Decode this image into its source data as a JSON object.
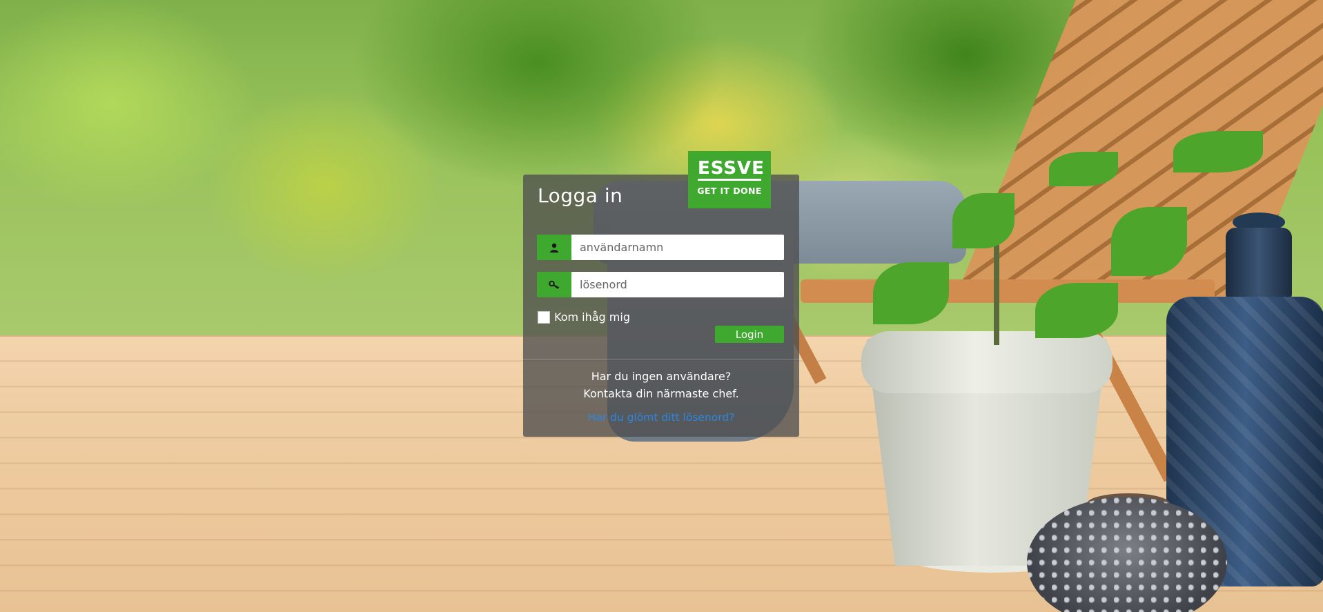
{
  "login": {
    "title": "Logga in",
    "username_placeholder": "användarnamn",
    "password_placeholder": "lösenord",
    "remember_label": "Kom ihåg mig",
    "login_button": "Login",
    "no_account_line1": "Har du ingen användare?",
    "no_account_line2": "Kontakta din närmaste chef.",
    "forgot_link": "Har du glömt ditt lösenord?"
  },
  "logo": {
    "word": "ESSVE",
    "tagline": "GET IT DONE"
  },
  "icons": {
    "username": "user-icon",
    "password": "key-icon"
  },
  "colors": {
    "brand_green": "#3fa82f",
    "link_blue": "#2c86e0",
    "panel_bg": "rgba(78,78,78,0.78)"
  }
}
